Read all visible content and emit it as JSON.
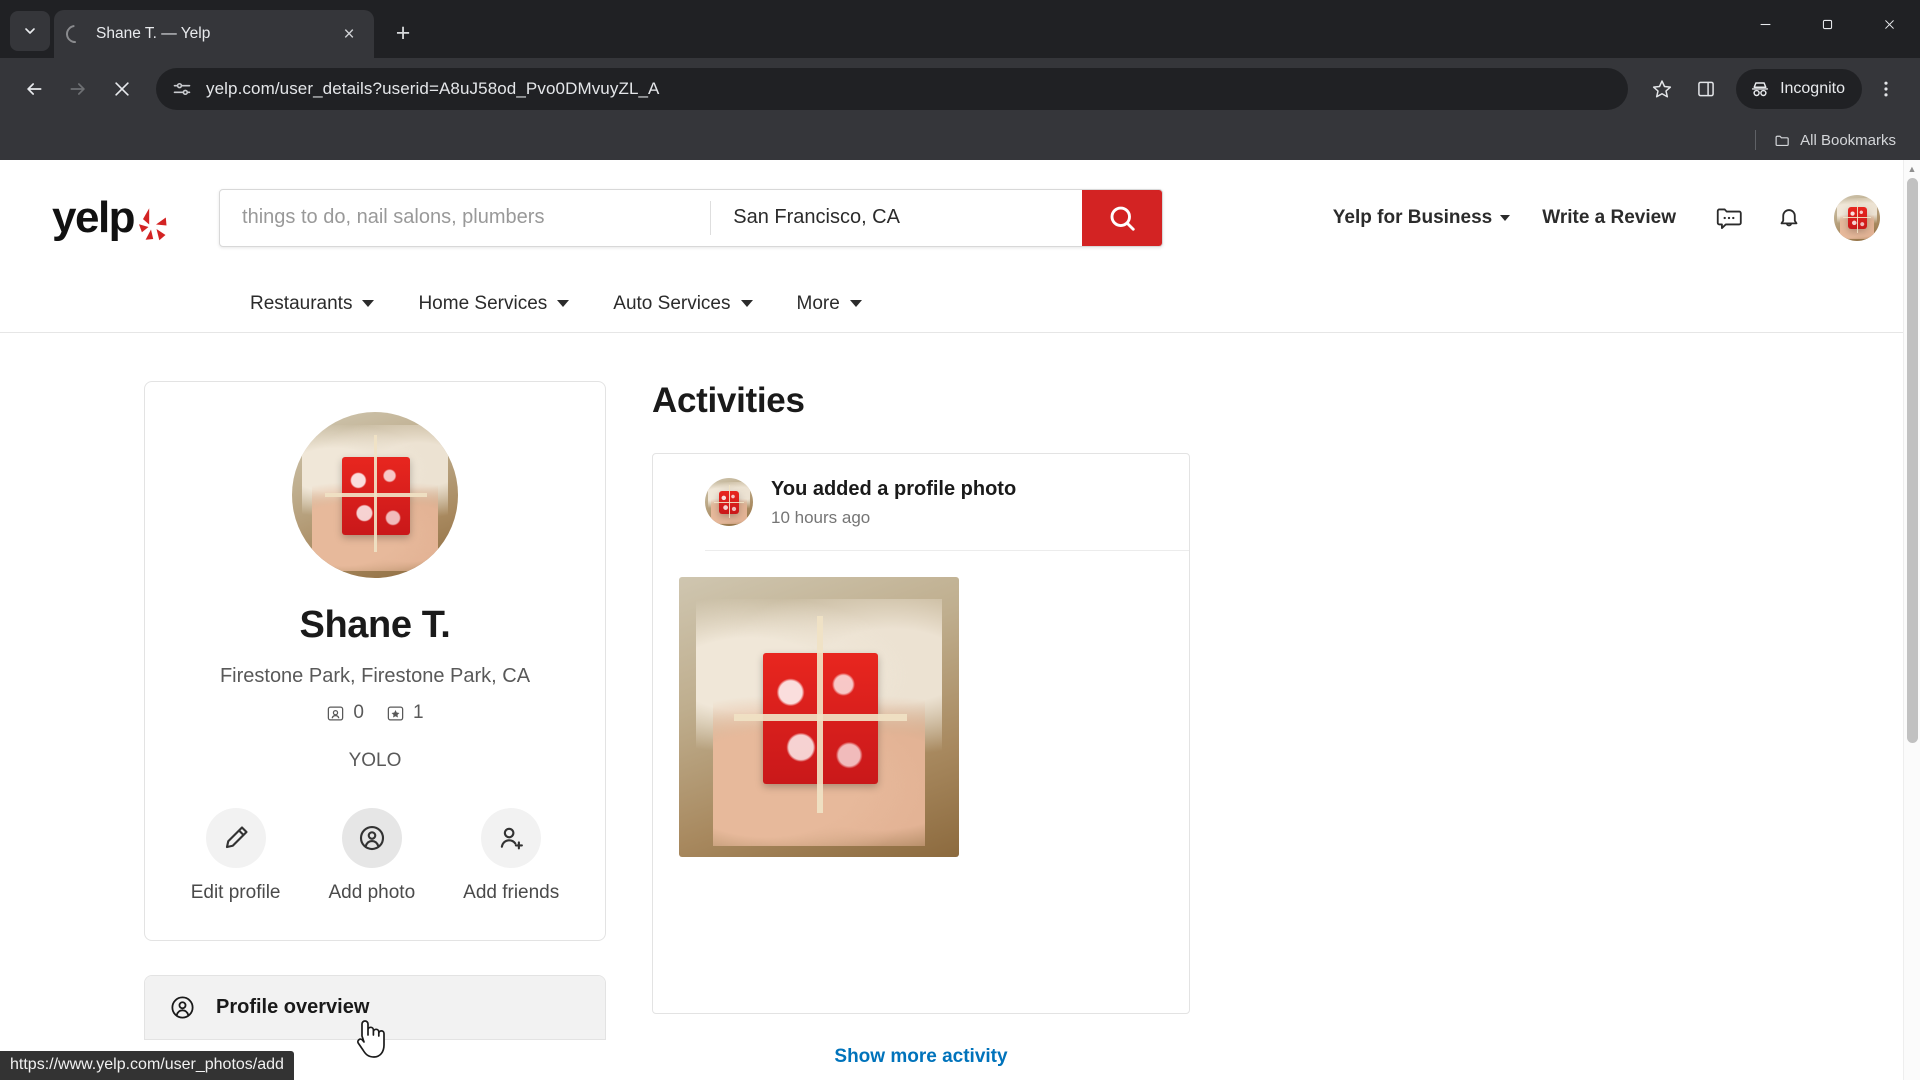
{
  "browser": {
    "tab": {
      "title": "Shane T. — Yelp",
      "loading": true
    },
    "new_tab_label": "+",
    "close_label": "×",
    "url": "yelp.com/user_details?userid=A8uJ58od_Pvo0DMvuyZL_A",
    "incognito_label": "Incognito",
    "bookmarks_label": "All Bookmarks",
    "status_url": "https://www.yelp.com/user_photos/add"
  },
  "header": {
    "logo_text": "yelp",
    "search": {
      "find_value": "",
      "find_placeholder": "things to do, nail salons, plumbers",
      "near_value": "San Francisco, CA",
      "near_placeholder": "San Francisco, CA"
    },
    "links": [
      {
        "label": "Yelp for Business",
        "has_chevron": true
      },
      {
        "label": "Write a Review",
        "has_chevron": false
      }
    ],
    "icons": [
      "messages-icon",
      "notifications-icon",
      "user-avatar"
    ]
  },
  "category_nav": {
    "items": [
      {
        "label": "Restaurants"
      },
      {
        "label": "Home Services"
      },
      {
        "label": "Auto Services"
      },
      {
        "label": "More"
      }
    ]
  },
  "profile": {
    "name": "Shane T.",
    "location": "Firestone Park, Firestone Park, CA",
    "stats": [
      {
        "icon": "friends-icon",
        "value": "0"
      },
      {
        "icon": "reviews-star-icon",
        "value": "1"
      }
    ],
    "tagline": "YOLO",
    "actions": [
      {
        "label": "Edit profile",
        "icon": "pencil-icon",
        "hovered": false
      },
      {
        "label": "Add photo",
        "icon": "add-photo-icon",
        "hovered": true
      },
      {
        "label": "Add friends",
        "icon": "add-friend-icon",
        "hovered": false
      }
    ],
    "nav_items": [
      {
        "label": "Profile overview",
        "icon": "profile-overview-icon",
        "active": true
      }
    ]
  },
  "activities": {
    "title": "Activities",
    "items": [
      {
        "text": "You added a profile photo",
        "time": "10 hours ago",
        "photo": "gift-in-hands-photo"
      }
    ],
    "show_more_label": "Show more activity"
  },
  "colors": {
    "yelp_red": "#d32323",
    "link_blue": "#0073bb",
    "chrome_dark": "#35363a",
    "chrome_darker": "#202124"
  }
}
